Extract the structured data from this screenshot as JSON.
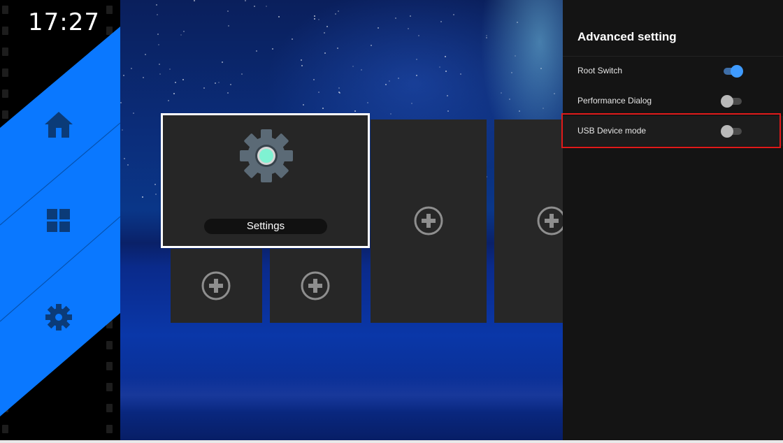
{
  "clock": {
    "time": "17:27"
  },
  "nav": {
    "items": [
      {
        "name": "home",
        "icon": "home-icon"
      },
      {
        "name": "apps",
        "icon": "windows-grid-icon"
      },
      {
        "name": "settings",
        "icon": "gear-icon"
      }
    ]
  },
  "tiles": {
    "settings_label": "Settings"
  },
  "panel": {
    "title": "Advanced setting",
    "rows": [
      {
        "label": "Root Switch",
        "state": "on"
      },
      {
        "label": "Performance Dialog",
        "state": "off"
      },
      {
        "label": "USB Device mode",
        "state": "off"
      }
    ]
  },
  "colors": {
    "accent_blue": "#0a78ff",
    "toggle_on": "#3f9bff",
    "highlight_red": "#e01a1a",
    "panel_bg": "#141414",
    "tile_bg": "#272727"
  }
}
